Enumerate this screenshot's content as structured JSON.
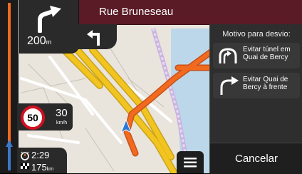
{
  "street": {
    "name": "Rue Bruneseau"
  },
  "maneuver": {
    "distance_value": "200",
    "distance_unit": "m",
    "icon": "turn-right-icon",
    "next_icon": "turn-left-icon"
  },
  "speed": {
    "limit": "50",
    "current": "30",
    "unit": "km/h"
  },
  "trip": {
    "eta": "2:29",
    "remaining_value": "175",
    "remaining_unit": "km"
  },
  "menu": {
    "icon": "hamburger-menu-icon"
  },
  "detour_panel": {
    "title": "Motivo para desvio:",
    "options": [
      {
        "label": "Evitar túnel em Quai de Bercy",
        "icon": "tunnel-avoid-icon"
      },
      {
        "label": "Evitar Quai de Bercy à frente",
        "icon": "u-turn-right-icon"
      }
    ],
    "cancel_label": "Cancelar"
  },
  "colors": {
    "road_major": "#f2c41f",
    "route": "#f26a1f",
    "bar_bg": "#5a1a26",
    "speed_ring": "#d01020"
  }
}
